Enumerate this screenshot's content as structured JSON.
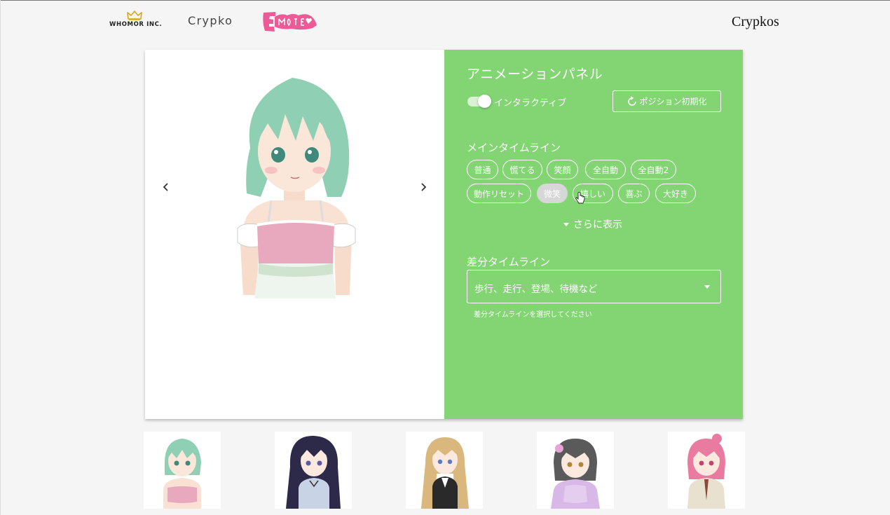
{
  "header": {
    "whomor_logo": "WHOMOR INC.",
    "crypko_logo": "Crypko",
    "emote_logo": "E-mote",
    "site_title": "Crypkos"
  },
  "viewer": {
    "prev_icon": "chevron-left-icon",
    "next_icon": "chevron-right-icon"
  },
  "panel": {
    "title": "アニメーションパネル",
    "interactive_label": "インタラクティブ",
    "interactive_on": true,
    "reset_label": "ポジション初期化",
    "main_timeline_label": "メインタイムライン",
    "main_timeline_items": [
      "普通",
      "慌てる",
      "笑顔",
      "全自動",
      "全自動2",
      "動作リセット",
      "微笑",
      "嬉しい",
      "喜ぶ",
      "大好き"
    ],
    "active_item": "微笑",
    "show_more_label": "さらに表示",
    "diff_timeline_label": "差分タイムライン",
    "diff_timeline_placeholder": "歩行、走行、登場、待機など",
    "diff_timeline_hint": "差分タイムラインを選択してください"
  },
  "colors": {
    "panel_bg": "#83d574",
    "page_bg": "#f5f5f5",
    "chip_active_bg": "#d7d7d7"
  },
  "thumbnails_count": 5
}
